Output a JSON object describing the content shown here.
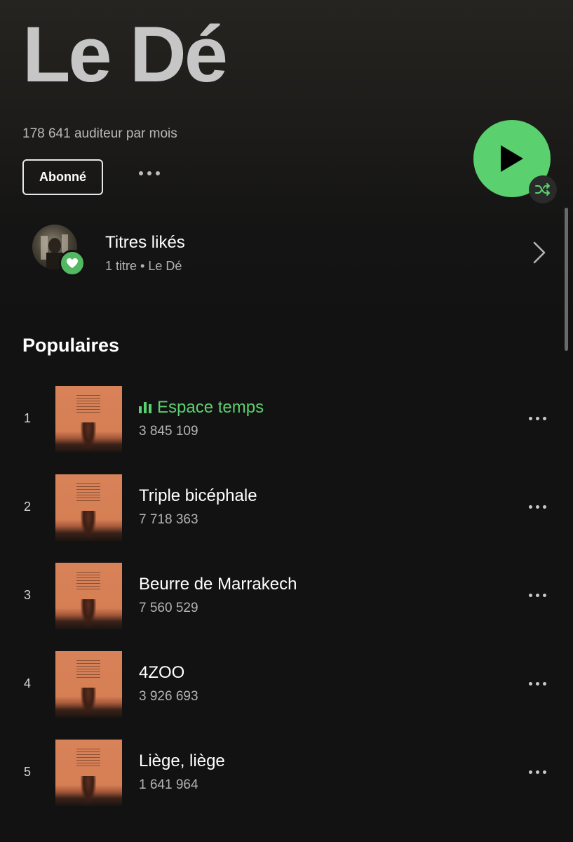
{
  "artist": {
    "name": "Le Dé",
    "monthly_listeners": "178 641 auditeur par mois",
    "follow_label": "Abonné"
  },
  "liked": {
    "title": "Titres likés",
    "subtitle": "1 titre • Le Dé"
  },
  "popular": {
    "title": "Populaires",
    "tracks": [
      {
        "rank": "1",
        "title": "Espace temps",
        "plays": "3 845 109",
        "playing": true
      },
      {
        "rank": "2",
        "title": "Triple bicéphale",
        "plays": "7 718 363",
        "playing": false
      },
      {
        "rank": "3",
        "title": "Beurre de Marrakech",
        "plays": "7 560 529",
        "playing": false
      },
      {
        "rank": "4",
        "title": "4ZOO",
        "plays": "3 926 693",
        "playing": false
      },
      {
        "rank": "5",
        "title": "Liège, liège",
        "plays": "1 641 964",
        "playing": false
      }
    ]
  },
  "colors": {
    "accent": "#5bd06e",
    "background": "#121212",
    "secondary_text": "#b3b3b3"
  },
  "icons": {
    "play": "play-icon",
    "shuffle": "shuffle-icon",
    "heart": "heart-icon",
    "chevron": "chevron-right-icon",
    "more": "more-horizontal-icon",
    "equalizer": "equalizer-icon"
  }
}
